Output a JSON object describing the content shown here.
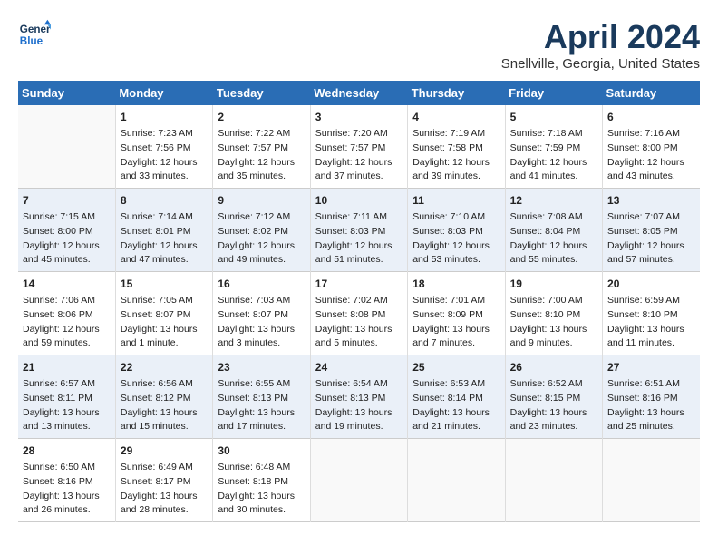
{
  "header": {
    "logo_line1": "General",
    "logo_line2": "Blue",
    "month_title": "April 2024",
    "location": "Snellville, Georgia, United States"
  },
  "weekdays": [
    "Sunday",
    "Monday",
    "Tuesday",
    "Wednesday",
    "Thursday",
    "Friday",
    "Saturday"
  ],
  "weeks": [
    [
      {
        "day": "",
        "sunrise": "",
        "sunset": "",
        "daylight": ""
      },
      {
        "day": "1",
        "sunrise": "Sunrise: 7:23 AM",
        "sunset": "Sunset: 7:56 PM",
        "daylight": "Daylight: 12 hours and 33 minutes."
      },
      {
        "day": "2",
        "sunrise": "Sunrise: 7:22 AM",
        "sunset": "Sunset: 7:57 PM",
        "daylight": "Daylight: 12 hours and 35 minutes."
      },
      {
        "day": "3",
        "sunrise": "Sunrise: 7:20 AM",
        "sunset": "Sunset: 7:57 PM",
        "daylight": "Daylight: 12 hours and 37 minutes."
      },
      {
        "day": "4",
        "sunrise": "Sunrise: 7:19 AM",
        "sunset": "Sunset: 7:58 PM",
        "daylight": "Daylight: 12 hours and 39 minutes."
      },
      {
        "day": "5",
        "sunrise": "Sunrise: 7:18 AM",
        "sunset": "Sunset: 7:59 PM",
        "daylight": "Daylight: 12 hours and 41 minutes."
      },
      {
        "day": "6",
        "sunrise": "Sunrise: 7:16 AM",
        "sunset": "Sunset: 8:00 PM",
        "daylight": "Daylight: 12 hours and 43 minutes."
      }
    ],
    [
      {
        "day": "7",
        "sunrise": "Sunrise: 7:15 AM",
        "sunset": "Sunset: 8:00 PM",
        "daylight": "Daylight: 12 hours and 45 minutes."
      },
      {
        "day": "8",
        "sunrise": "Sunrise: 7:14 AM",
        "sunset": "Sunset: 8:01 PM",
        "daylight": "Daylight: 12 hours and 47 minutes."
      },
      {
        "day": "9",
        "sunrise": "Sunrise: 7:12 AM",
        "sunset": "Sunset: 8:02 PM",
        "daylight": "Daylight: 12 hours and 49 minutes."
      },
      {
        "day": "10",
        "sunrise": "Sunrise: 7:11 AM",
        "sunset": "Sunset: 8:03 PM",
        "daylight": "Daylight: 12 hours and 51 minutes."
      },
      {
        "day": "11",
        "sunrise": "Sunrise: 7:10 AM",
        "sunset": "Sunset: 8:03 PM",
        "daylight": "Daylight: 12 hours and 53 minutes."
      },
      {
        "day": "12",
        "sunrise": "Sunrise: 7:08 AM",
        "sunset": "Sunset: 8:04 PM",
        "daylight": "Daylight: 12 hours and 55 minutes."
      },
      {
        "day": "13",
        "sunrise": "Sunrise: 7:07 AM",
        "sunset": "Sunset: 8:05 PM",
        "daylight": "Daylight: 12 hours and 57 minutes."
      }
    ],
    [
      {
        "day": "14",
        "sunrise": "Sunrise: 7:06 AM",
        "sunset": "Sunset: 8:06 PM",
        "daylight": "Daylight: 12 hours and 59 minutes."
      },
      {
        "day": "15",
        "sunrise": "Sunrise: 7:05 AM",
        "sunset": "Sunset: 8:07 PM",
        "daylight": "Daylight: 13 hours and 1 minute."
      },
      {
        "day": "16",
        "sunrise": "Sunrise: 7:03 AM",
        "sunset": "Sunset: 8:07 PM",
        "daylight": "Daylight: 13 hours and 3 minutes."
      },
      {
        "day": "17",
        "sunrise": "Sunrise: 7:02 AM",
        "sunset": "Sunset: 8:08 PM",
        "daylight": "Daylight: 13 hours and 5 minutes."
      },
      {
        "day": "18",
        "sunrise": "Sunrise: 7:01 AM",
        "sunset": "Sunset: 8:09 PM",
        "daylight": "Daylight: 13 hours and 7 minutes."
      },
      {
        "day": "19",
        "sunrise": "Sunrise: 7:00 AM",
        "sunset": "Sunset: 8:10 PM",
        "daylight": "Daylight: 13 hours and 9 minutes."
      },
      {
        "day": "20",
        "sunrise": "Sunrise: 6:59 AM",
        "sunset": "Sunset: 8:10 PM",
        "daylight": "Daylight: 13 hours and 11 minutes."
      }
    ],
    [
      {
        "day": "21",
        "sunrise": "Sunrise: 6:57 AM",
        "sunset": "Sunset: 8:11 PM",
        "daylight": "Daylight: 13 hours and 13 minutes."
      },
      {
        "day": "22",
        "sunrise": "Sunrise: 6:56 AM",
        "sunset": "Sunset: 8:12 PM",
        "daylight": "Daylight: 13 hours and 15 minutes."
      },
      {
        "day": "23",
        "sunrise": "Sunrise: 6:55 AM",
        "sunset": "Sunset: 8:13 PM",
        "daylight": "Daylight: 13 hours and 17 minutes."
      },
      {
        "day": "24",
        "sunrise": "Sunrise: 6:54 AM",
        "sunset": "Sunset: 8:13 PM",
        "daylight": "Daylight: 13 hours and 19 minutes."
      },
      {
        "day": "25",
        "sunrise": "Sunrise: 6:53 AM",
        "sunset": "Sunset: 8:14 PM",
        "daylight": "Daylight: 13 hours and 21 minutes."
      },
      {
        "day": "26",
        "sunrise": "Sunrise: 6:52 AM",
        "sunset": "Sunset: 8:15 PM",
        "daylight": "Daylight: 13 hours and 23 minutes."
      },
      {
        "day": "27",
        "sunrise": "Sunrise: 6:51 AM",
        "sunset": "Sunset: 8:16 PM",
        "daylight": "Daylight: 13 hours and 25 minutes."
      }
    ],
    [
      {
        "day": "28",
        "sunrise": "Sunrise: 6:50 AM",
        "sunset": "Sunset: 8:16 PM",
        "daylight": "Daylight: 13 hours and 26 minutes."
      },
      {
        "day": "29",
        "sunrise": "Sunrise: 6:49 AM",
        "sunset": "Sunset: 8:17 PM",
        "daylight": "Daylight: 13 hours and 28 minutes."
      },
      {
        "day": "30",
        "sunrise": "Sunrise: 6:48 AM",
        "sunset": "Sunset: 8:18 PM",
        "daylight": "Daylight: 13 hours and 30 minutes."
      },
      {
        "day": "",
        "sunrise": "",
        "sunset": "",
        "daylight": ""
      },
      {
        "day": "",
        "sunrise": "",
        "sunset": "",
        "daylight": ""
      },
      {
        "day": "",
        "sunrise": "",
        "sunset": "",
        "daylight": ""
      },
      {
        "day": "",
        "sunrise": "",
        "sunset": "",
        "daylight": ""
      }
    ]
  ]
}
